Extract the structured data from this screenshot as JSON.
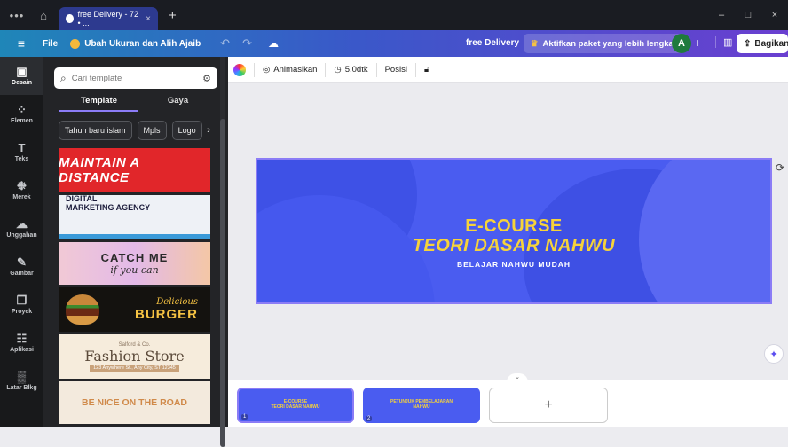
{
  "titlebar": {
    "tab_title": "free Delivery - 72 • ...",
    "close_glyph": "×",
    "new_tab": "+"
  },
  "window": {
    "minimize": "–",
    "maximize": "□",
    "close": "×"
  },
  "toolbar": {
    "file": "File",
    "resize": "Ubah Ukuran dan Alih Ajaib",
    "doc_name": "free Delivery",
    "upgrade": "Aktifkan paket yang lebih lengkap",
    "avatar": "A",
    "add": "+",
    "share": "Bagikan"
  },
  "rail": {
    "items": [
      {
        "label": "Desain",
        "icon": "▣"
      },
      {
        "label": "Elemen",
        "icon": "⁘"
      },
      {
        "label": "Teks",
        "icon": "T"
      },
      {
        "label": "Merek",
        "icon": "❉"
      },
      {
        "label": "Unggahan",
        "icon": "☁"
      },
      {
        "label": "Gambar",
        "icon": "✎"
      },
      {
        "label": "Proyek",
        "icon": "❐"
      },
      {
        "label": "Aplikasi",
        "icon": "☷"
      },
      {
        "label": "Latar Blkg",
        "icon": "▒"
      }
    ]
  },
  "panel": {
    "search_placeholder": "Cari template",
    "tabs": [
      {
        "label": "Template"
      },
      {
        "label": "Gaya"
      }
    ],
    "chips": [
      {
        "label": "Tahun baru islam"
      },
      {
        "label": "Mpls"
      },
      {
        "label": "Logo"
      }
    ],
    "templates": {
      "t1": "MAINTAIN A DISTANCE",
      "t2a": "DIGITAL",
      "t2b": "MARKETING AGENCY",
      "t3a": "CATCH ME",
      "t3b": "if you can",
      "t4a": "Delicious",
      "t4b": "BURGER",
      "t5a": "Salford & Co.",
      "t5b": "Fashion Store",
      "t5c": "123 Anywhere St., Any City, ST 12345",
      "t6": "BE NICE ON THE ROAD"
    }
  },
  "ctxbar": {
    "animate": "Animasikan",
    "duration": "5.0dtk",
    "position": "Posisi"
  },
  "design": {
    "title1": "E-COURSE",
    "title2": "TEORI DASAR NAHWU",
    "subtitle": "BELAJAR NAHWU MUDAH"
  },
  "filmstrip": {
    "pages": [
      {
        "num": "1",
        "text1": "E-COURSE",
        "text2": "TEORI DASAR NAHWU"
      },
      {
        "num": "2",
        "text1": "PETUNJUK PEMBELAJARAN",
        "text2": "NAHWU"
      }
    ],
    "add": "+"
  }
}
